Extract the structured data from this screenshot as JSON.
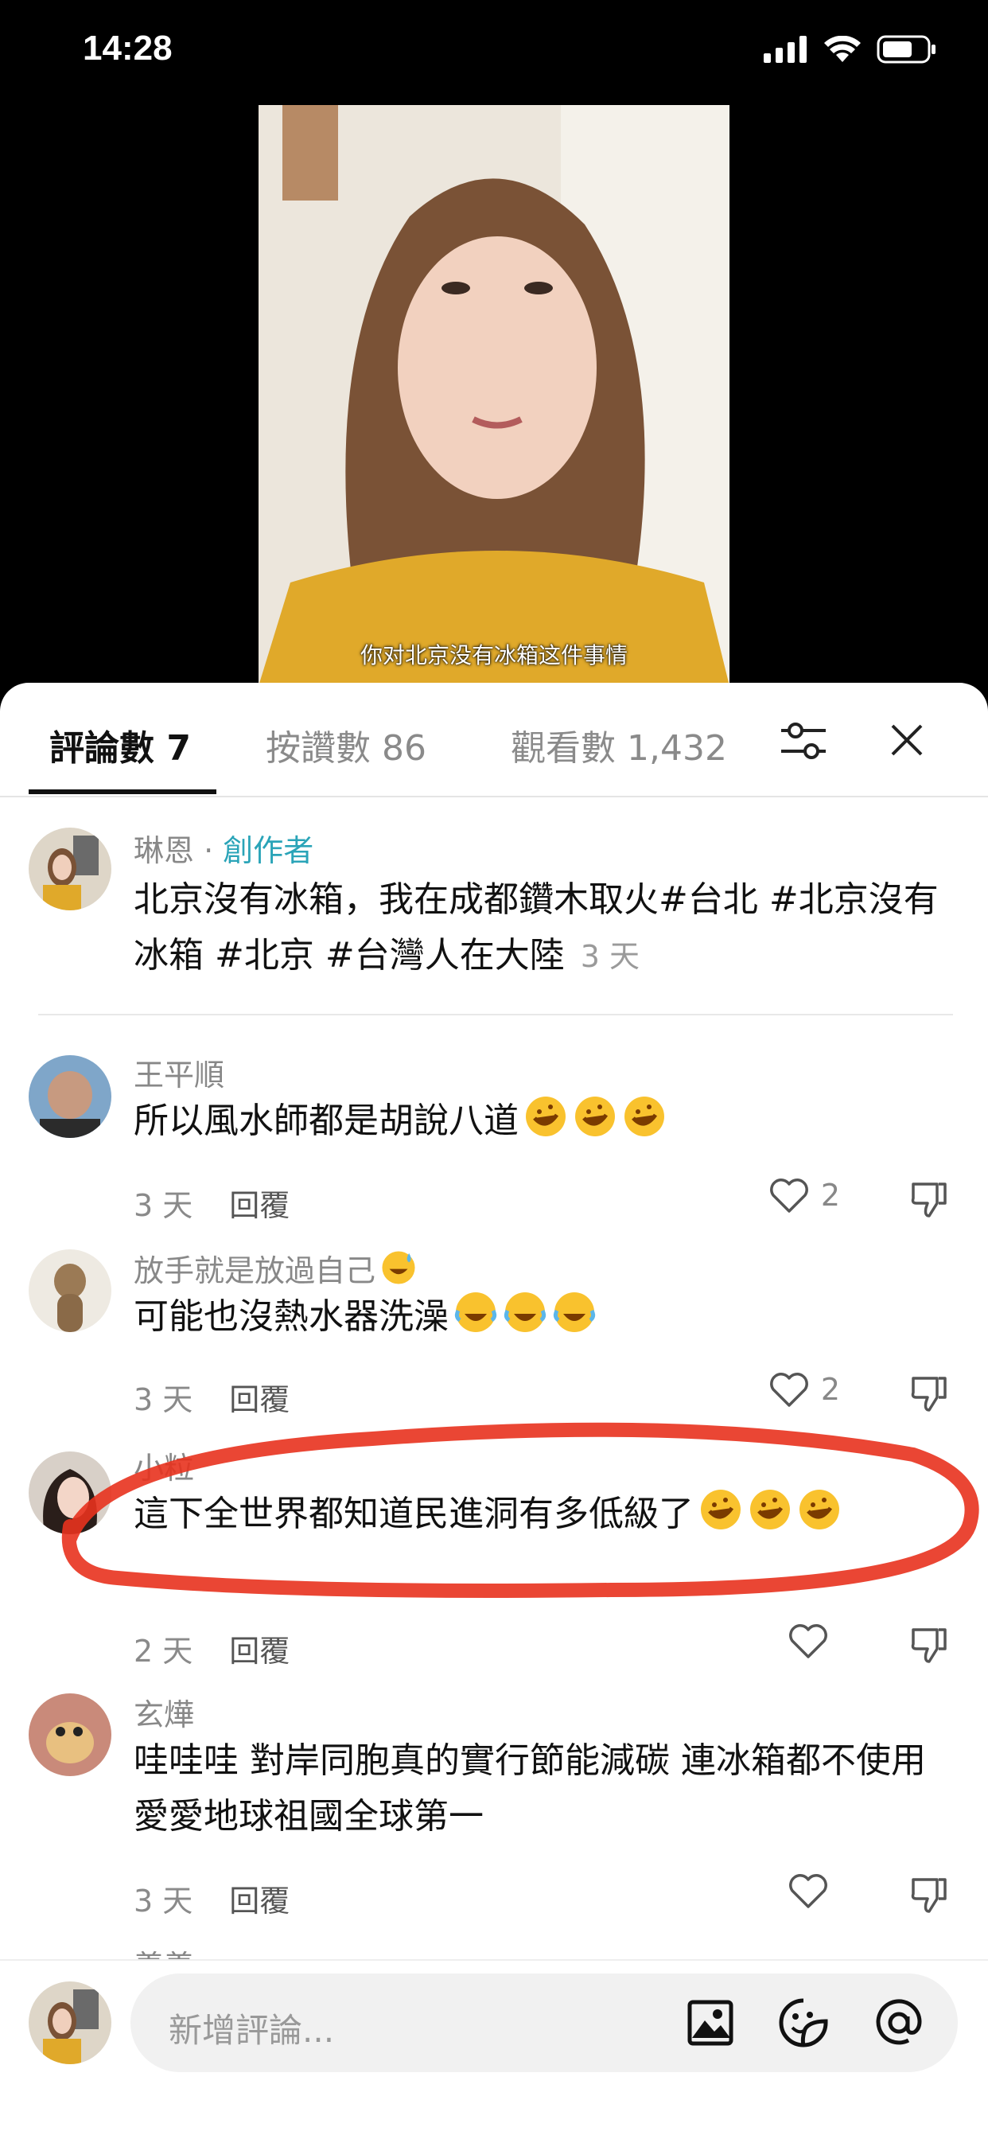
{
  "status": {
    "time": "14:28"
  },
  "video": {
    "caption": "你对北京没有冰箱这件事情"
  },
  "tabs": [
    {
      "label": "評論數 7"
    },
    {
      "label": "按讚數 86"
    },
    {
      "label": "觀看數 1,432"
    }
  ],
  "post": {
    "author": "琳恩",
    "separator": " · ",
    "badge": "創作者",
    "text": "北京沒有冰箱，我在成都鑽木取火#台北 #北京沒有冰箱 #北京 #台灣人在大陸",
    "ago": "3 天"
  },
  "comments": [
    {
      "author": "王平順",
      "text": "所以風水師都是胡說八道",
      "emojis": [
        "rofl-emoji",
        "rofl-emoji",
        "rofl-emoji"
      ],
      "ago": "3 天",
      "reply": "回覆",
      "likes": "2"
    },
    {
      "author": "放手就是放過自己",
      "text": "可能也沒熱水器洗澡",
      "emojis": [
        "joy-emoji",
        "joy-emoji",
        "joy-emoji"
      ],
      "ago": "3 天",
      "reply": "回覆",
      "likes": "2"
    },
    {
      "author": "小粒",
      "text": "這下全世界都知道民進洞有多低級了",
      "emojis": [
        "rofl-emoji",
        "rofl-emoji",
        "rofl-emoji"
      ],
      "ago": "2 天",
      "reply": "回覆",
      "likes": ""
    },
    {
      "author": "玄燁",
      "text": "哇哇哇 對岸同胞真的實行節能減碳 連冰箱都不使用 愛愛地球祖國全球第一",
      "emojis": [],
      "ago": "3 天",
      "reply": "回覆",
      "likes": ""
    }
  ],
  "partial_author": "義義",
  "composer": {
    "placeholder": "新增評論..."
  },
  "icons": [
    "filter-icon",
    "close-icon",
    "heart-icon",
    "dislike-icon",
    "image-icon",
    "sticker-icon",
    "mention-icon"
  ],
  "colors": {
    "accent": "#2aa4b8",
    "highlight": "#e8321e"
  }
}
